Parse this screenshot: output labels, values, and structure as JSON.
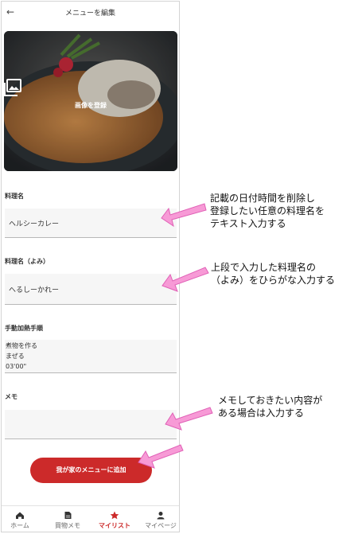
{
  "header": {
    "back_icon": "arrow-left-icon",
    "title": "メニューを編集"
  },
  "photo": {
    "button_label": "画像を登録",
    "icon": "image-icon"
  },
  "fields": {
    "name": {
      "label": "料理名",
      "value": "ヘルシーカレー"
    },
    "yomi": {
      "label": "料理名（よみ）",
      "value": "へるしーかれー"
    },
    "steps": {
      "label": "手動加熱手順",
      "value": "煮物を作る\nまぜる\n03'00\""
    },
    "memo": {
      "label": "メモ",
      "value": ""
    }
  },
  "cta": {
    "label": "我が家のメニューに追加"
  },
  "tabs": [
    {
      "label": "ホーム",
      "icon": "home-icon"
    },
    {
      "label": "買物メモ",
      "icon": "memo-icon"
    },
    {
      "label": "マイリスト",
      "icon": "star-icon",
      "active": true
    },
    {
      "label": "マイページ",
      "icon": "person-icon"
    }
  ],
  "notes": {
    "n1": [
      "記載の日付時間を削除し",
      "登録したい任意の料理名を",
      "テキスト入力する"
    ],
    "n2": [
      "上段で入力した料理名の",
      "（よみ）をひらがな入力する"
    ],
    "n3": [
      "メモしておきたい内容が",
      "ある場合は入力する"
    ]
  },
  "colors": {
    "accent": "#cc2a2a",
    "annotation_arrow": "#f79ad6"
  }
}
